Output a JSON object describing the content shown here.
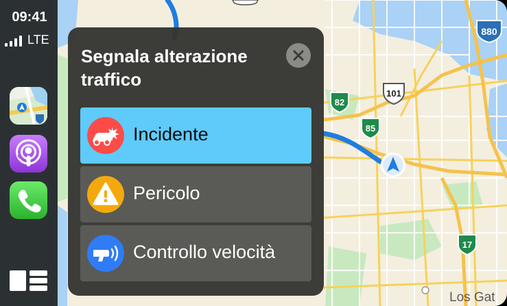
{
  "status": {
    "time": "09:41",
    "network": "LTE"
  },
  "sidebar": {
    "apps": [
      {
        "name": "Maps",
        "icon": "maps-app-icon"
      },
      {
        "name": "Podcasts",
        "icon": "podcasts-app-icon"
      },
      {
        "name": "Phone",
        "icon": "phone-app-icon"
      }
    ],
    "dashboard_icon": "dashboard-icon"
  },
  "map": {
    "highway_shields": [
      "880",
      "101",
      "82",
      "85",
      "17"
    ],
    "place_label": "Los Gat",
    "colors": {
      "land": "#f4eedf",
      "water": "#aad1f6",
      "park": "#c8e9c0",
      "road": "#f6d25a",
      "route": "#1f7de0"
    }
  },
  "panel": {
    "title": "Segnala alterazione traffico",
    "close_icon": "close-icon",
    "options": [
      {
        "label": "Incidente",
        "icon": "crash-icon",
        "color": "#fd4c47",
        "selected": true
      },
      {
        "label": "Pericolo",
        "icon": "warning-icon",
        "color": "#f3a90e",
        "selected": false
      },
      {
        "label": "Controllo velocità",
        "icon": "speed-camera-icon",
        "color": "#2f7cf6",
        "selected": false
      }
    ],
    "highlight_color": "#5ecbfa"
  }
}
